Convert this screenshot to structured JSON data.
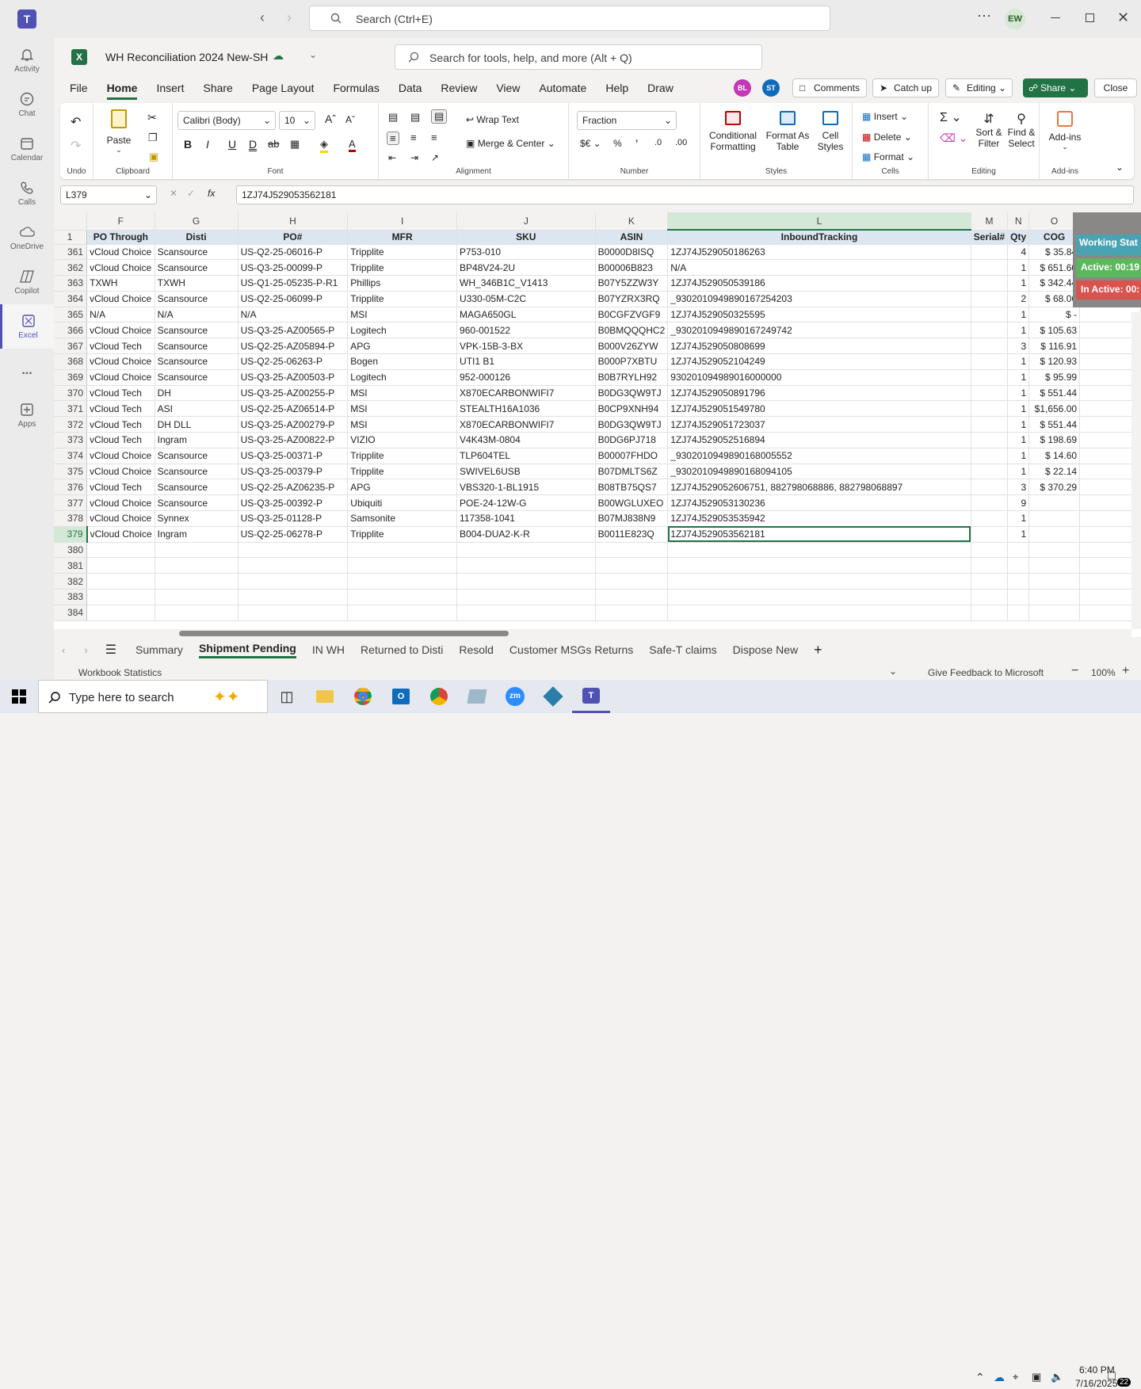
{
  "teams": {
    "search_placeholder": "Search (Ctrl+E)",
    "avatar": "EW"
  },
  "rail": [
    {
      "label": "Activity",
      "icon": "bell-icon"
    },
    {
      "label": "Chat",
      "icon": "chat-icon"
    },
    {
      "label": "Calendar",
      "icon": "calendar-icon"
    },
    {
      "label": "Calls",
      "icon": "phone-icon"
    },
    {
      "label": "OneDrive",
      "icon": "cloud-icon"
    },
    {
      "label": "Copilot",
      "icon": "copilot-icon"
    },
    {
      "label": "Excel",
      "icon": "excel-icon"
    },
    {
      "label": "...",
      "icon": "more-icon"
    },
    {
      "label": "Apps",
      "icon": "plus-square-icon"
    }
  ],
  "workbook": {
    "title": "WH Reconciliation 2024 New-SH",
    "search_placeholder": "Search for tools, help, and more (Alt + Q)"
  },
  "presence": [
    "BL",
    "ST"
  ],
  "actions": {
    "comments": "Comments",
    "catchup": "Catch up",
    "editing": "Editing",
    "share": "Share",
    "close": "Close"
  },
  "ribbon_tabs": [
    "File",
    "Home",
    "Insert",
    "Share",
    "Page Layout",
    "Formulas",
    "Data",
    "Review",
    "View",
    "Automate",
    "Help",
    "Draw"
  ],
  "ribbon": {
    "undo": "Undo",
    "paste": "Paste",
    "clipboard": "Clipboard",
    "font_name": "Calibri (Body)",
    "font_size": "10",
    "font": "Font",
    "wrap": "Wrap Text",
    "merge": "Merge & Center",
    "alignment": "Alignment",
    "numfmt": "Fraction",
    "number": "Number",
    "cond": "Conditional",
    "cond2": "Formatting",
    "fmt_table": "Format As",
    "fmt_table2": "Table",
    "cell_styles": "Cell",
    "cell_styles2": "Styles",
    "styles": "Styles",
    "insert": "Insert",
    "delete": "Delete",
    "format": "Format",
    "cells": "Cells",
    "sort": "Sort &",
    "sort2": "Filter",
    "find": "Find &",
    "find2": "Select",
    "editing": "Editing",
    "addins": "Add-ins",
    "addins_grp": "Add-ins"
  },
  "name_box": "L379",
  "formula": "1ZJ74J529053562181",
  "columns": [
    "F",
    "G",
    "H",
    "I",
    "J",
    "K",
    "L",
    "M",
    "N",
    "O"
  ],
  "headers": [
    "PO Through",
    "Disti",
    "PO#",
    "MFR",
    "SKU",
    "ASIN",
    "InboundTracking",
    "Serial#",
    "Qty",
    "COG"
  ],
  "rows": [
    {
      "r": "361",
      "c": [
        "vCloud Choice",
        "Scansource",
        "US-Q2-25-06016-P",
        "Tripplite",
        "P753-010",
        "B0000D8ISQ",
        "1ZJ74J529050186263",
        "",
        "4",
        "$     35.84"
      ]
    },
    {
      "r": "362",
      "c": [
        "vCloud Choice",
        "Scansource",
        "US-Q3-25-00099-P",
        "Tripplite",
        "BP48V24-2U",
        "B00006B823",
        "N/A",
        "",
        "1",
        "$   651.60"
      ]
    },
    {
      "r": "363",
      "c": [
        "TXWH",
        "TXWH",
        "US-Q1-25-05235-P-R1",
        "Phillips",
        "WH_346B1C_V1413",
        "B07Y5ZZW3Y",
        "1ZJ74J529050539186",
        "",
        "1",
        "$   342.44"
      ]
    },
    {
      "r": "364",
      "c": [
        "vCloud Choice",
        "Scansource",
        "US-Q2-25-06099-P",
        "Tripplite",
        "U330-05M-C2C",
        "B07YZRX3RQ",
        "_9302010949890167254203",
        "",
        "2",
        "$     68.06"
      ]
    },
    {
      "r": "365",
      "c": [
        "N/A",
        "N/A",
        "N/A",
        "MSI",
        "MAGA650GL",
        "B0CGFZVGF9",
        "1ZJ74J529050325595",
        "",
        "1",
        "$           -"
      ]
    },
    {
      "r": "366",
      "c": [
        "vCloud Choice",
        "Scansource",
        "US-Q3-25-AZ00565-P",
        "Logitech",
        "960-001522",
        "B0BMQQQHC2",
        "_9302010949890167249742",
        "",
        "1",
        "$   105.63"
      ]
    },
    {
      "r": "367",
      "c": [
        "vCloud Tech",
        "Scansource",
        "US-Q2-25-AZ05894-P",
        "APG",
        "VPK-15B-3-BX",
        "B000V26ZYW",
        "1ZJ74J529050808699",
        "",
        "3",
        "$   116.91"
      ]
    },
    {
      "r": "368",
      "c": [
        "vCloud Choice",
        "Scansource",
        "US-Q2-25-06263-P",
        "Bogen",
        "UTI1 B1",
        "B000P7XBTU",
        "1ZJ74J529052104249",
        "",
        "1",
        "$   120.93"
      ]
    },
    {
      "r": "369",
      "c": [
        "vCloud Choice",
        "Scansource",
        "US-Q3-25-AZ00503-P",
        "Logitech",
        "952-000126",
        "B0B7RYLH92",
        "930201094989016000000",
        "",
        "1",
        "$     95.99"
      ]
    },
    {
      "r": "370",
      "c": [
        "vCloud Tech",
        "DH",
        "US-Q3-25-AZ00255-P",
        "MSI",
        "X870ECARBONWIFI7",
        "B0DG3QW9TJ",
        "1ZJ74J529050891796",
        "",
        "1",
        "$   551.44"
      ]
    },
    {
      "r": "371",
      "c": [
        "vCloud Tech",
        "ASI",
        "US-Q2-25-AZ06514-P",
        "MSI",
        "STEALTH16A1036",
        "B0CP9XNH94",
        "1ZJ74J529051549780",
        "",
        "1",
        "$1,656.00"
      ]
    },
    {
      "r": "372",
      "c": [
        "vCloud Tech",
        "DH DLL",
        "US-Q3-25-AZ00279-P",
        "MSI",
        "X870ECARBONWIFI7",
        "B0DG3QW9TJ",
        "1ZJ74J529051723037",
        "",
        "1",
        "$   551.44"
      ]
    },
    {
      "r": "373",
      "c": [
        "vCloud Tech",
        "Ingram",
        "US-Q3-25-AZ00822-P",
        "VIZIO",
        "V4K43M-0804",
        "B0DG6PJ718",
        "1ZJ74J529052516894",
        "",
        "1",
        "$   198.69"
      ]
    },
    {
      "r": "374",
      "c": [
        "vCloud Choice",
        "Scansource",
        "US-Q3-25-00371-P",
        "Tripplite",
        "TLP604TEL",
        "B00007FHDO",
        "_9302010949890168005552",
        "",
        "1",
        "$     14.60"
      ]
    },
    {
      "r": "375",
      "c": [
        "vCloud Choice",
        "Scansource",
        "US-Q3-25-00379-P",
        "Tripplite",
        "SWIVEL6USB",
        "B07DMLTS6Z",
        "_9302010949890168094105",
        "",
        "1",
        "$     22.14"
      ]
    },
    {
      "r": "376",
      "c": [
        "vCloud Tech",
        "Scansource",
        "US-Q2-25-AZ06235-P",
        "APG",
        "VBS320-1-BL1915",
        "B08TB75QS7",
        "1ZJ74J529052606751, 882798068886, 882798068897",
        "",
        "3",
        "$   370.29"
      ]
    },
    {
      "r": "377",
      "c": [
        "vCloud Choice",
        "Scansource",
        "US-Q3-25-00392-P",
        "Ubiquiti",
        "POE-24-12W-G",
        "B00WGLUXEO",
        "1ZJ74J529053130236",
        "",
        "9",
        ""
      ]
    },
    {
      "r": "378",
      "c": [
        "vCloud Choice",
        "Synnex",
        "US-Q3-25-01128-P",
        "Samsonite",
        "117358-1041",
        "B07MJ838N9",
        "1ZJ74J529053535942",
        "",
        "1",
        ""
      ]
    },
    {
      "r": "379",
      "c": [
        "vCloud Choice",
        "Ingram",
        "US-Q2-25-06278-P",
        "Tripplite",
        "B004-DUA2-K-R",
        "B0011E823Q",
        "1ZJ74J529053562181",
        "",
        "1",
        ""
      ]
    }
  ],
  "empty_rows": [
    "380",
    "381",
    "382",
    "383",
    "384"
  ],
  "side_panel": {
    "title": "Working Stat",
    "active": "Active: 00:19",
    "inactive": "In Active: 00:"
  },
  "sheets": [
    "Summary",
    "Shipment Pending",
    "IN WH",
    "Returned to Disti",
    "Resold",
    "Customer MSGs Returns",
    "Safe-T claims",
    "Dispose New"
  ],
  "status": {
    "left": "Workbook Statistics",
    "feedback": "Give Feedback to Microsoft",
    "zoom": "100%"
  },
  "taskbar": {
    "search_placeholder": "Type here to search",
    "time": "6:40 PM",
    "date": "7/16/2025",
    "notif": "22"
  }
}
